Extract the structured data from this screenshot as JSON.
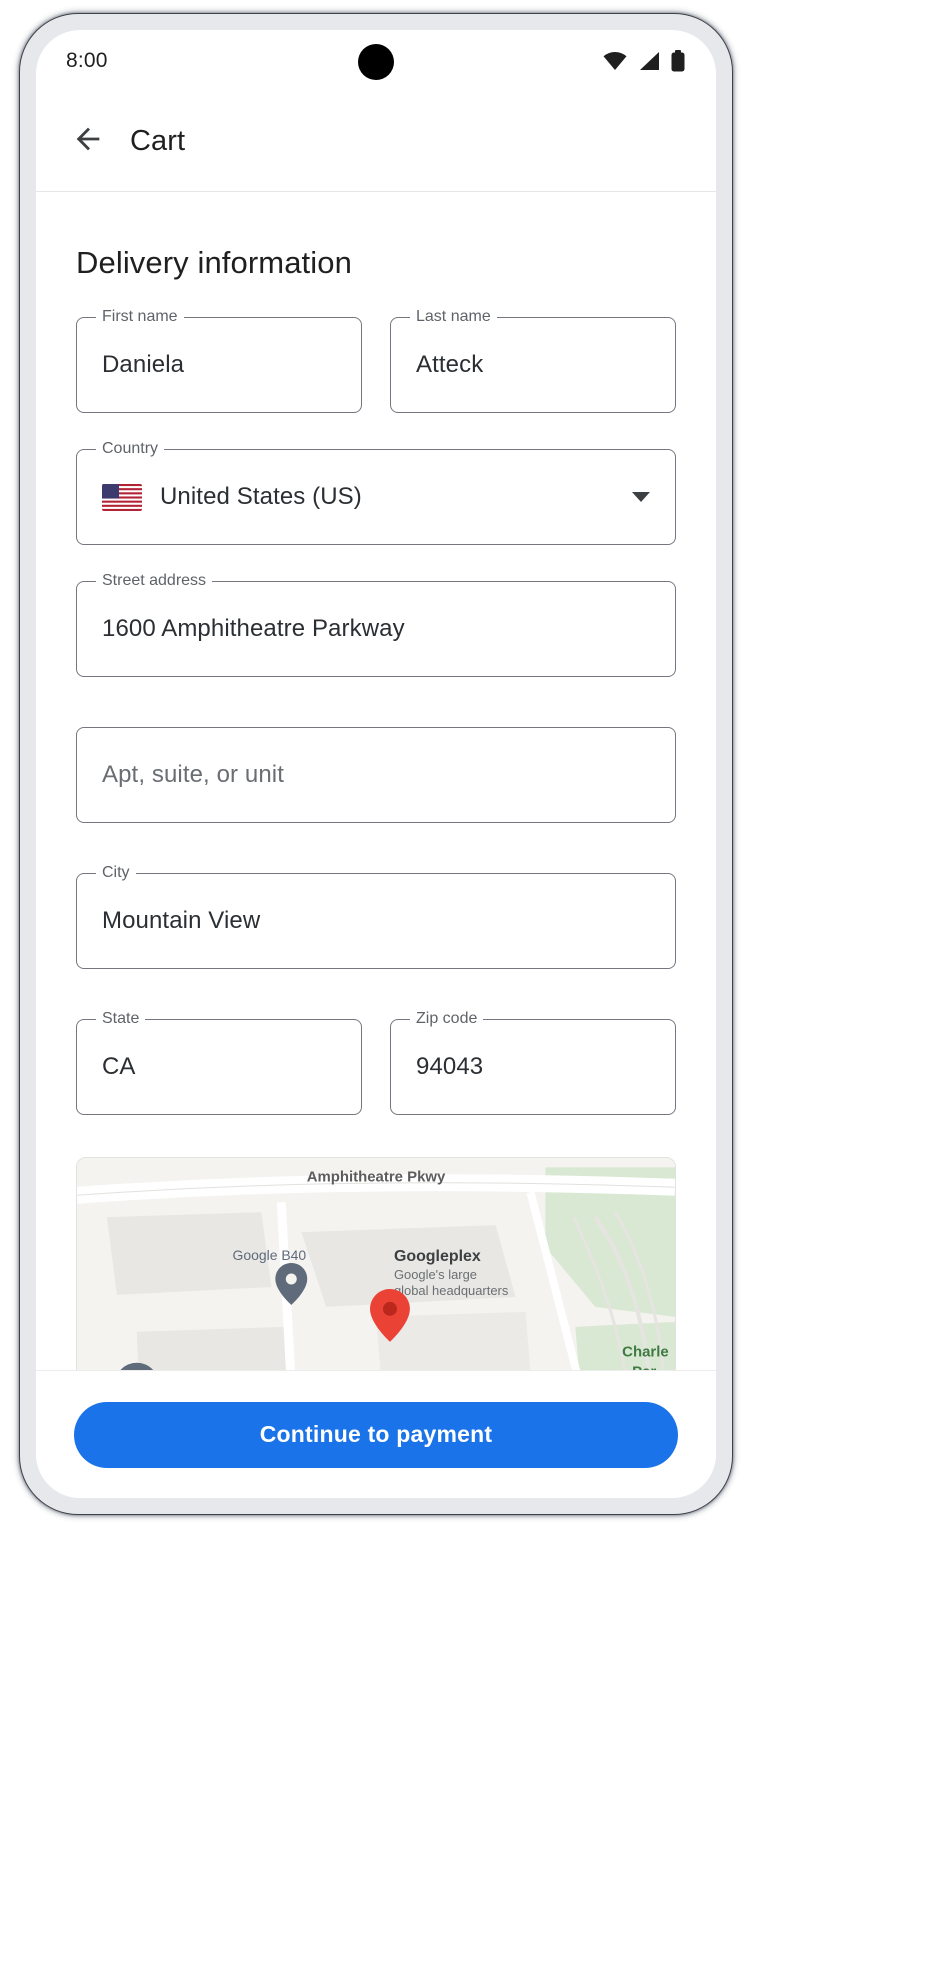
{
  "status_bar": {
    "time": "8:00",
    "icons": [
      "wifi-icon",
      "cellular-signal-icon",
      "battery-icon"
    ]
  },
  "app_bar": {
    "back_icon": "arrow-back-icon",
    "title": "Cart"
  },
  "main": {
    "section_title": "Delivery information",
    "fields": {
      "first_name": {
        "label": "First name",
        "value": "Daniela"
      },
      "last_name": {
        "label": "Last name",
        "value": "Atteck"
      },
      "country": {
        "label": "Country",
        "value": "United States (US)",
        "flag": "🇺🇸"
      },
      "street": {
        "label": "Street address",
        "value": "1600 Amphitheatre Parkway"
      },
      "apt": {
        "label": "",
        "value": "",
        "placeholder": "Apt, suite, or unit"
      },
      "city": {
        "label": "City",
        "value": "Mountain View"
      },
      "state": {
        "label": "State",
        "value": "CA"
      },
      "zip": {
        "label": "Zip code",
        "value": "94043"
      }
    },
    "map": {
      "street_label": "Amphitheatre Pkwy",
      "poi_b40": "Google B40",
      "poi_googleplex": "Googleplex",
      "poi_googleplex_sub1": "Google's large",
      "poi_googleplex_sub2": "global headquarters",
      "poi_charleston_1": "Charle",
      "poi_charleston_2": "Par"
    }
  },
  "bottom_bar": {
    "cta_label": "Continue to payment"
  },
  "colors": {
    "accent": "#1a73e8",
    "text_primary": "#1f1f1f",
    "text_secondary": "#5f6368",
    "field_outline": "#74777f",
    "marker_red": "#ea4335",
    "marker_grey": "#5f6b7a"
  }
}
